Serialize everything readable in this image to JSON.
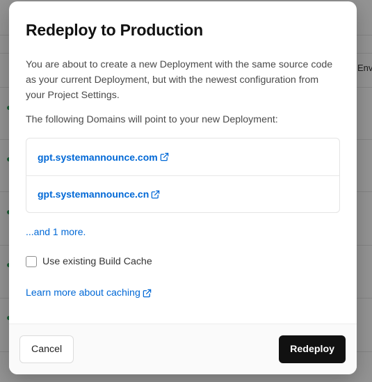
{
  "background": {
    "header_text": "Env"
  },
  "modal": {
    "title": "Redeploy to Production",
    "description": "You are about to create a new Deployment with the same source code as your current Deployment, but with the newest configuration from your Project Settings.",
    "domains_lead": "The following Domains will point to your new Deployment:",
    "domains": [
      {
        "label": "gpt.systemannounce.com",
        "icon": "external-link-icon"
      },
      {
        "label": "gpt.systemannounce.cn",
        "icon": "external-link-icon"
      }
    ],
    "more_link": "...and 1 more.",
    "checkbox": {
      "label": "Use existing Build Cache",
      "checked": false
    },
    "learn_link": "Learn more about caching",
    "cancel_label": "Cancel",
    "redeploy_label": "Redeploy"
  },
  "colors": {
    "link": "#0068d6",
    "primary_button": "#111111",
    "overlay": "rgba(0,0,0,0.42)"
  }
}
